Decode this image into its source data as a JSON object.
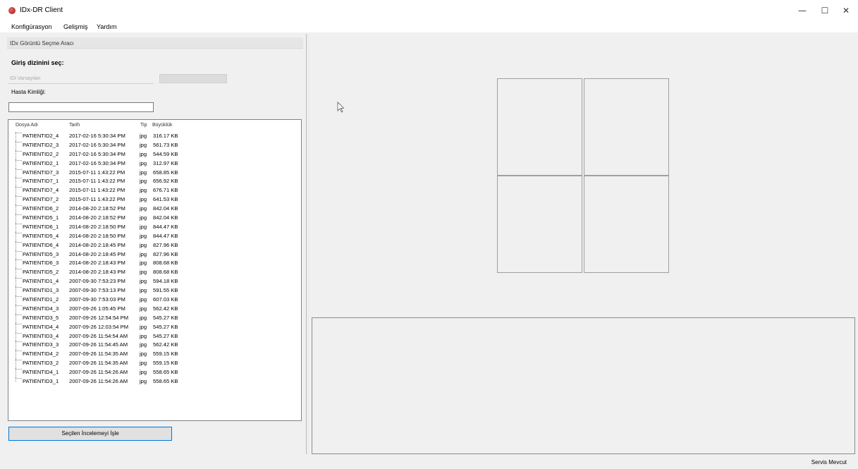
{
  "window": {
    "title": "IDx-DR Client",
    "controls": {
      "minimize": "—",
      "maximize": "☐",
      "close": "✕"
    }
  },
  "menu": {
    "items": [
      "Konfigürasyon",
      "Gelişmiş",
      "Yardım"
    ]
  },
  "tool": {
    "header": "IDx Görüntü Seçme Aracı",
    "input_dir_label": "Giriş dizinini seç:",
    "input_dir_placeholder": "IDI Varsayılan",
    "input_dir_button": "",
    "patient_label": "Hasta Kimliği:",
    "patient_value": ""
  },
  "file_list": {
    "columns": [
      "Dosya Adı",
      "Tarih",
      "Tip",
      "Büyüklük"
    ],
    "rows": [
      [
        "PATIENTID2_4",
        "2017-02-16 5:30:34 PM",
        "jpg",
        "316.17 KB"
      ],
      [
        "PATIENTID2_3",
        "2017-02-16 5:30:34 PM",
        "jpg",
        "561.73 KB"
      ],
      [
        "PATIENTID2_2",
        "2017-02-16 5:30:34 PM",
        "jpg",
        "544.59 KB"
      ],
      [
        "PATIENTID2_1",
        "2017-02-16 5:30:34 PM",
        "jpg",
        "312.97 KB"
      ],
      [
        "PATIENTID7_3",
        "2015-07-11 1:43:22 PM",
        "jpg",
        "658.85 KB"
      ],
      [
        "PATIENTID7_1",
        "2015-07-11 1:43:22 PM",
        "jpg",
        "656.92 KB"
      ],
      [
        "PATIENTID7_4",
        "2015-07-11 1:43:22 PM",
        "jpg",
        "676.71 KB"
      ],
      [
        "PATIENTID7_2",
        "2015-07-11 1:43:22 PM",
        "jpg",
        "641.53 KB"
      ],
      [
        "PATIENTID6_2",
        "2014-08-20 2:18:52 PM",
        "jpg",
        "842.04 KB"
      ],
      [
        "PATIENTID5_1",
        "2014-08-20 2:18:52 PM",
        "jpg",
        "842.04 KB"
      ],
      [
        "PATIENTID6_1",
        "2014-08-20 2:18:50 PM",
        "jpg",
        "844.47 KB"
      ],
      [
        "PATIENTID5_4",
        "2014-08-20 2:18:50 PM",
        "jpg",
        "844.47 KB"
      ],
      [
        "PATIENTID6_4",
        "2014-08-20 2:18:45 PM",
        "jpg",
        "827.96 KB"
      ],
      [
        "PATIENTID5_3",
        "2014-08-20 2:18:45 PM",
        "jpg",
        "827.96 KB"
      ],
      [
        "PATIENTID6_3",
        "2014-08-20 2:18:43 PM",
        "jpg",
        "808.68 KB"
      ],
      [
        "PATIENTID5_2",
        "2014-08-20 2:18:43 PM",
        "jpg",
        "808.68 KB"
      ],
      [
        "PATIENTID1_4",
        "2007-09-30 7:53:23 PM",
        "jpg",
        "594.18 KB"
      ],
      [
        "PATIENTID1_3",
        "2007-09-30 7:53:13 PM",
        "jpg",
        "591.55 KB"
      ],
      [
        "PATIENTID1_2",
        "2007-09-30 7:53:03 PM",
        "jpg",
        "607.03 KB"
      ],
      [
        "PATIENTID4_3",
        "2007-09-26 1:05:45 PM",
        "jpg",
        "562.42 KB"
      ],
      [
        "PATIENTID3_5",
        "2007-09-26 12:54:54 PM",
        "jpg",
        "545.27 KB"
      ],
      [
        "PATIENTID4_4",
        "2007-09-26 12:03:54 PM",
        "jpg",
        "545.27 KB"
      ],
      [
        "PATIENTID3_4",
        "2007-09-26 11:54:54 AM",
        "jpg",
        "545.27 KB"
      ],
      [
        "PATIENTID3_3",
        "2007-09-26 11:54:45 AM",
        "jpg",
        "562.42 KB"
      ],
      [
        "PATIENTID4_2",
        "2007-09-26 11:54:35 AM",
        "jpg",
        "559.15 KB"
      ],
      [
        "PATIENTID3_2",
        "2007-09-26 11:54:35 AM",
        "jpg",
        "559.15 KB"
      ],
      [
        "PATIENTID4_1",
        "2007-09-26 11:54:26 AM",
        "jpg",
        "558.65 KB"
      ],
      [
        "PATIENTID3_1",
        "2007-09-26 11:54:26 AM",
        "jpg",
        "558.65 KB"
      ]
    ]
  },
  "actions": {
    "process_button": "Seçilen İncelemeyi İşle"
  },
  "viewer": {
    "tile_count": 4,
    "cursor_icon": "mouse-pointer-icon"
  },
  "status": {
    "text": "Servis Mevcut"
  }
}
